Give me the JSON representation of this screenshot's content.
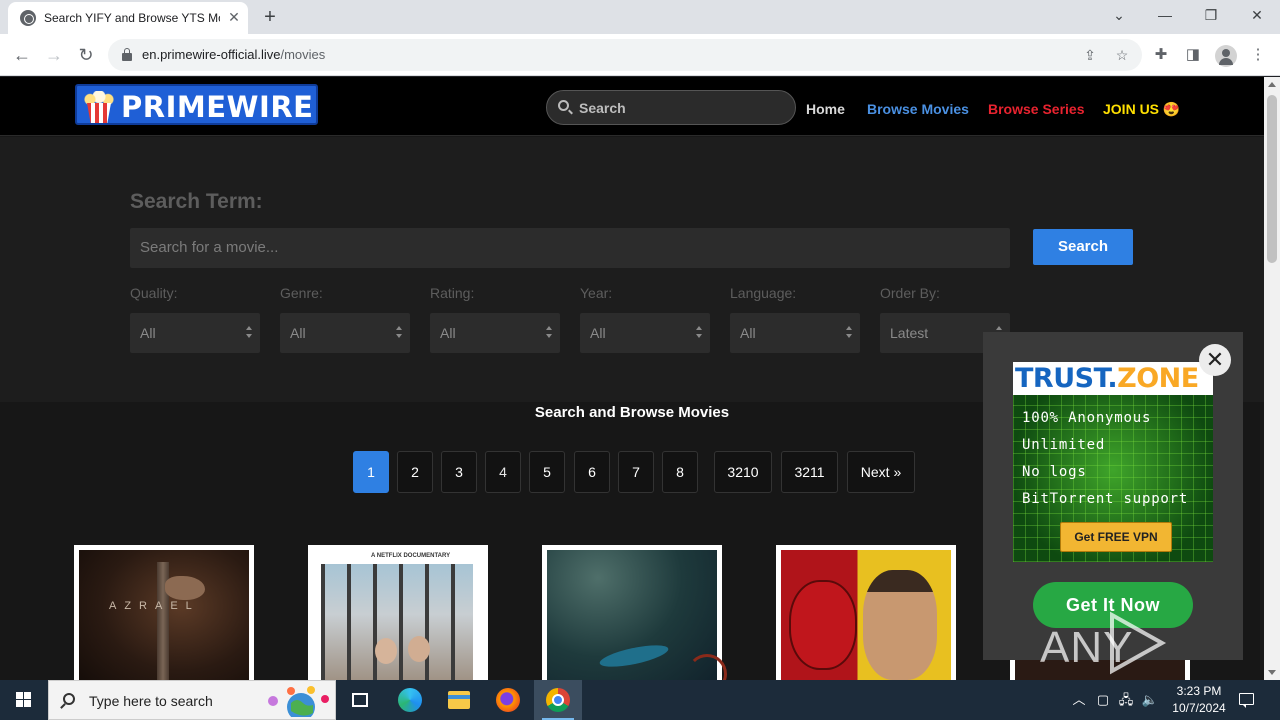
{
  "browser": {
    "tab_title": "Search YIFY and Browse YTS Mo",
    "tab_close": "✕",
    "new_tab": "+",
    "url_domain": "en.primewire-official.live",
    "url_path": "/movies"
  },
  "site": {
    "logo_prime": "PRIME",
    "logo_wire": "WIRE",
    "header_search_placeholder": "Search",
    "nav": {
      "home": "Home",
      "browse_movies": "Browse Movies",
      "browse_series": "Browse Series",
      "join": "JOIN US 😍"
    },
    "colors": {
      "browse_movies": "#4a90e2",
      "browse_series": "#e8232f",
      "join": "#ffe000",
      "accent": "#2f80e3"
    }
  },
  "filters": {
    "search_term_label": "Search Term:",
    "search_placeholder": "Search for a movie...",
    "search_button": "Search",
    "quality": {
      "label": "Quality:",
      "value": "All"
    },
    "genre": {
      "label": "Genre:",
      "value": "All"
    },
    "rating": {
      "label": "Rating:",
      "value": "All"
    },
    "year": {
      "label": "Year:",
      "value": "All"
    },
    "language": {
      "label": "Language:",
      "value": "All"
    },
    "order_by": {
      "label": "Order By:",
      "value": "Latest"
    }
  },
  "listing": {
    "title": "Search and Browse Movies",
    "pages": [
      "1",
      "2",
      "3",
      "4",
      "5",
      "6",
      "7",
      "8",
      "3210",
      "3211",
      "Next »"
    ],
    "current_page": "1",
    "poster_netflix_tag": "A NETFLIX DOCUMENTARY",
    "poster_title_text": "AZRAEL"
  },
  "ad": {
    "brand_trust": "TRUST.",
    "brand_zone": "ZONE",
    "features": [
      "100% Anonymous",
      "Unlimited",
      "No logs",
      "BitTorrent support"
    ],
    "vpn_button": "Get FREE VPN",
    "cta_button": "Get It Now",
    "close": "✕"
  },
  "watermark": "ANY RUN",
  "taskbar": {
    "search_placeholder": "Type here to search",
    "time": "3:23 PM",
    "date": "10/7/2024"
  }
}
